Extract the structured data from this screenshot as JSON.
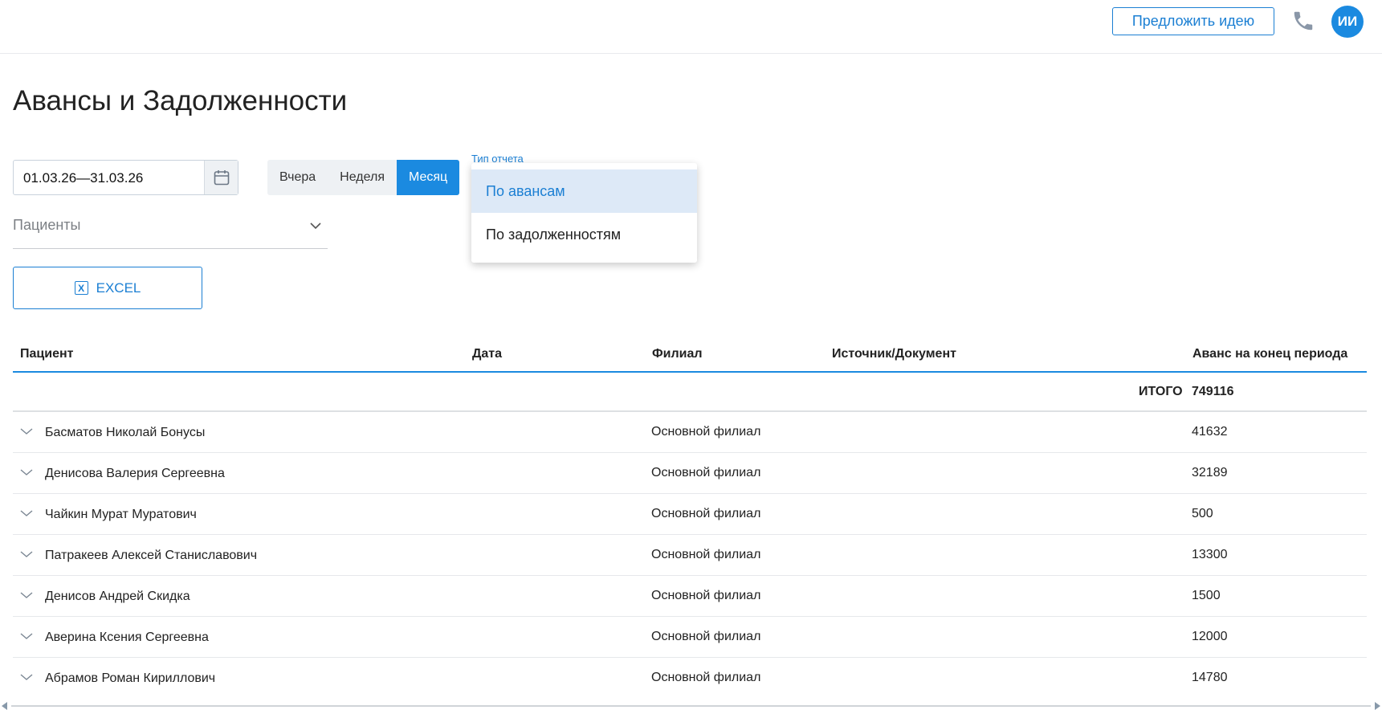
{
  "header": {
    "idea_button": "Предложить идею",
    "avatar_initials": "ИИ",
    "phone_icon": "phone-icon"
  },
  "page": {
    "title": "Авансы и Задолженности"
  },
  "filters": {
    "date_range": "01.03.26—31.03.26",
    "period_buttons": [
      {
        "label": "Вчера",
        "active": false
      },
      {
        "label": "Неделя",
        "active": false
      },
      {
        "label": "Месяц",
        "active": true
      }
    ],
    "patients_placeholder": "Пациенты",
    "report_type_label": "Тип отчета",
    "report_type_options": [
      {
        "label": "По авансам",
        "selected": true
      },
      {
        "label": "По задолженностям",
        "selected": false
      }
    ],
    "excel_button": "EXCEL"
  },
  "table": {
    "columns": [
      "Пациент",
      "Дата",
      "Филиал",
      "Источник/Документ",
      "Аванс на конец периода"
    ],
    "total_label": "ИТОГО",
    "total_value": "749116",
    "rows": [
      {
        "patient": "Басматов Николай Бонусы",
        "date": "",
        "branch": "Основной филиал",
        "source": "",
        "advance": "41632"
      },
      {
        "patient": "Денисова Валерия Сергеевна",
        "date": "",
        "branch": "Основной филиал",
        "source": "",
        "advance": "32189"
      },
      {
        "patient": "Чайкин Мурат Муратович",
        "date": "",
        "branch": "Основной филиал",
        "source": "",
        "advance": "500"
      },
      {
        "patient": "Патракеев Алексей Станиславович",
        "date": "",
        "branch": "Основной филиал",
        "source": "",
        "advance": "13300"
      },
      {
        "patient": "Денисов Андрей Скидка",
        "date": "",
        "branch": "Основной филиал",
        "source": "",
        "advance": "1500"
      },
      {
        "patient": "Аверина Ксения Сергеевна",
        "date": "",
        "branch": "Основной филиал",
        "source": "",
        "advance": "12000"
      },
      {
        "patient": "Абрамов Роман Кириллович",
        "date": "",
        "branch": "Основной филиал",
        "source": "",
        "advance": "14780"
      }
    ]
  },
  "colors": {
    "accent": "#1b8ae0",
    "selected_bg": "#dde9f7"
  }
}
